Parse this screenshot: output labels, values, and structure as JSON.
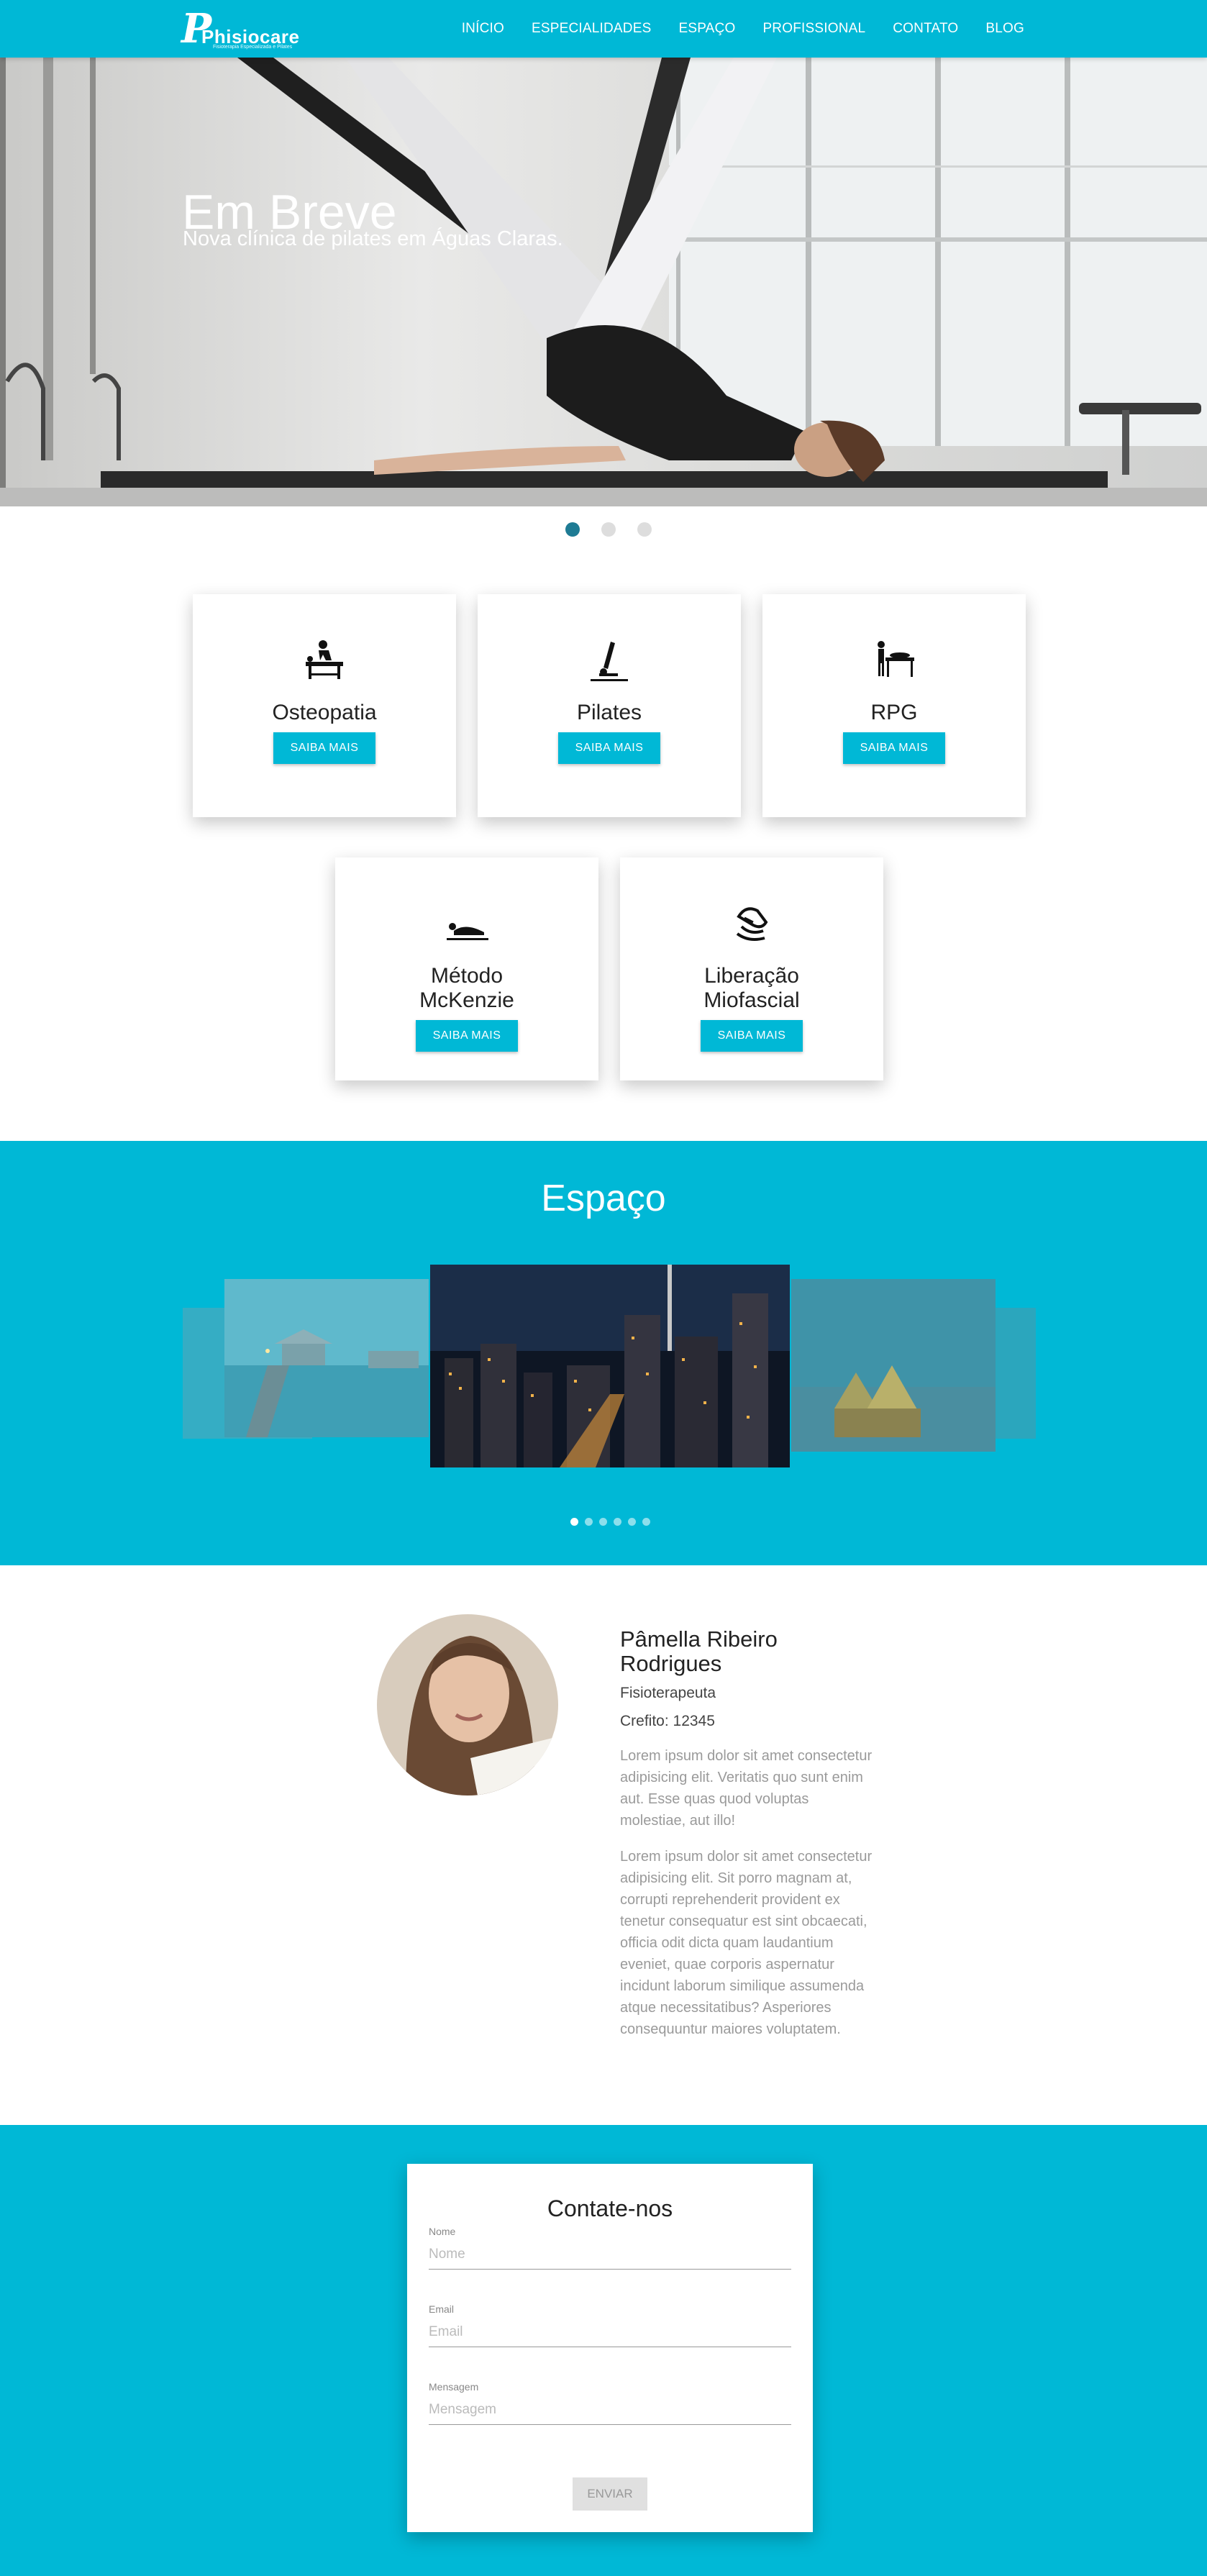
{
  "nav": {
    "logo_text": "Phisiocare",
    "logo_tagline": "Fisioterapia Especializada e Pilates",
    "items": [
      "INÍCIO",
      "ESPECIALIDADES",
      "ESPAÇO",
      "PROFISSIONAL",
      "CONTATO",
      "BLOG"
    ]
  },
  "hero": {
    "title": "Em Breve",
    "subtitle": "Nova clínica de pilates em Águas Claras.",
    "active_slide": 1,
    "slide_count": 3
  },
  "services": {
    "button_label": "SAIBA MAIS",
    "items": [
      {
        "title": "Osteopatia",
        "icon": "osteopathy-icon"
      },
      {
        "title": "Pilates",
        "icon": "pilates-icon"
      },
      {
        "title": "RPG",
        "icon": "rpg-icon"
      },
      {
        "title_line1": "Método",
        "title_line2": "McKenzie",
        "icon": "mckenzie-icon"
      },
      {
        "title_line1": "Liberação",
        "title_line2": "Miofascial",
        "icon": "myofascial-icon"
      }
    ]
  },
  "espaco": {
    "title": "Espaço",
    "slide_count": 6,
    "active_slide": 1
  },
  "profile": {
    "name": "Pâmella Ribeiro Rodrigues",
    "role": "Fisioterapeuta",
    "crefito": "Crefito: 12345",
    "paragraph1": "Lorem ipsum dolor sit amet consectetur adipisicing elit. Veritatis quo sunt enim aut. Esse quas quod voluptas molestiae, aut illo!",
    "paragraph2": "Lorem ipsum dolor sit amet consectetur adipisicing elit. Sit porro magnam at, corrupti reprehenderit provident ex tenetur consequatur est sint obcaecati, officia odit dicta quam laudantium eveniet, quae corporis aspernatur incidunt laborum similique assumenda atque necessitatibus? Asperiores consequuntur maiores voluptatem."
  },
  "contact": {
    "title": "Contate-nos",
    "name_label": "Nome",
    "name_placeholder": "Nome",
    "email_label": "Email",
    "email_placeholder": "Email",
    "message_label": "Mensagem",
    "message_placeholder": "Mensagem",
    "submit_label": "ENVIAR"
  },
  "colors": {
    "brand": "#00b8d6",
    "dot_active": "#1e7b94"
  }
}
